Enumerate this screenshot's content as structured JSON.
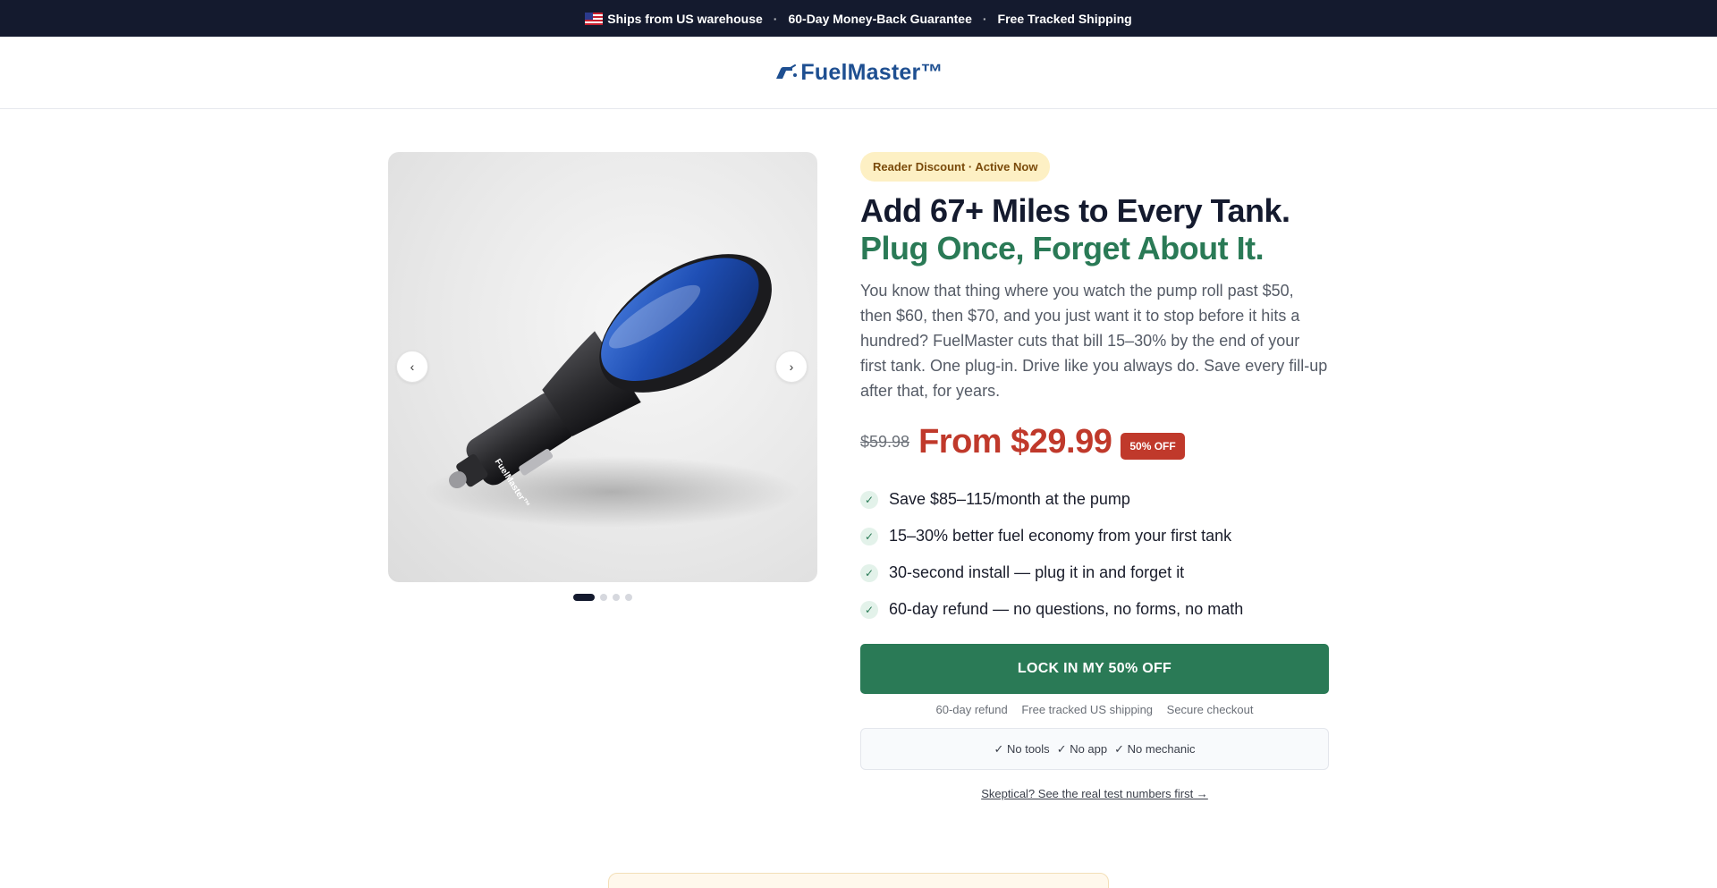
{
  "topbar": {
    "flag_icon": "us-flag-icon",
    "items": [
      "Ships from US warehouse",
      "60-Day Money-Back Guarantee",
      "Free Tracked Shipping"
    ],
    "separator": "·"
  },
  "header": {
    "logo_icon": "fuel-nozzle-icon",
    "logo_text": "FuelMaster™",
    "brand_color": "#1e4f91"
  },
  "gallery": {
    "product_label": "FuelMaster™",
    "prev_icon": "chevron-left-icon",
    "next_icon": "chevron-right-icon",
    "slide_count": 4,
    "active_slide": 1
  },
  "offer": {
    "pill": "Reader Discount · Active Now",
    "headline_1": "Add 67+ Miles to Every Tank.",
    "headline_2": "Plug Once, Forget About It.",
    "description": "You know that thing where you watch the pump roll past $50, then $60, then $70, and you just want it to stop before it hits a hundred? FuelMaster cuts that bill 15–30% by the end of your first tank. One plug-in. Drive like you always do. Save every fill-up after that, for years.",
    "old_price": "$59.98",
    "new_price": "From $29.99",
    "off_badge": "50% OFF",
    "benefits": [
      "Save $85–115/month at the pump",
      "15–30% better fuel economy from your first tank",
      "30-second install — plug it in and forget it",
      "60-day refund — no questions, no forms, no math"
    ],
    "check_glyph": "✓",
    "cta": "LOCK IN MY 50% OFF",
    "trust": [
      "60-day refund",
      "Free tracked US shipping",
      "Secure checkout"
    ],
    "assurances": [
      "✓ No tools",
      "✓ No app",
      "✓ No mechanic"
    ],
    "skeptic_link": "Skeptical? See the real test numbers first →",
    "accent_green": "#2a7a56",
    "price_red": "#c0392b"
  }
}
